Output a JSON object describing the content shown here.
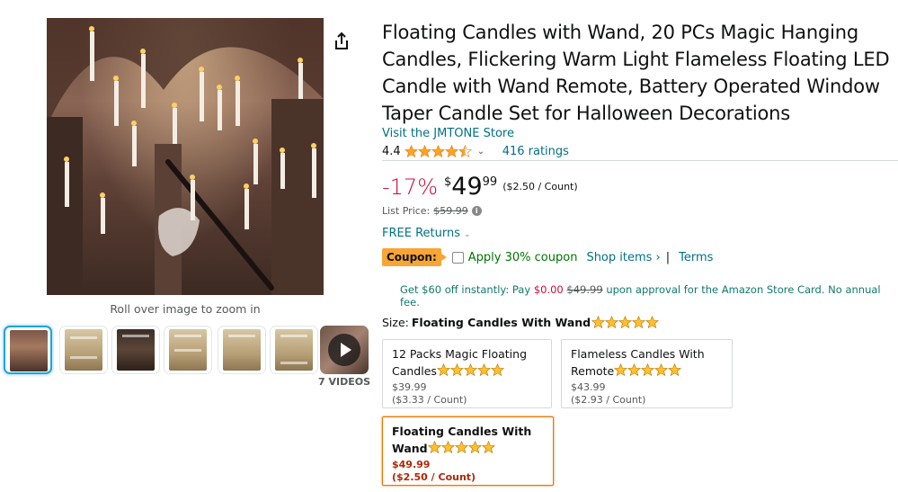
{
  "product": {
    "title": "Floating Candles with Wand, 20 PCs Magic Hanging Candles, Flickering Warm Light Flameless Floating LED Candle with Wand Remote, Battery Operated Window Taper Candle Set for Halloween Decorations",
    "store_link": "Visit the JMTONE Store",
    "rating": "4.4",
    "stars_icon": "star-rating-4.5-icon",
    "ratings_count": "416 ratings"
  },
  "price": {
    "discount": "-17%",
    "currency": "$",
    "whole": "49",
    "fraction": "99",
    "per_unit": "($2.50 / Count)",
    "list_price_label": "List Price:",
    "list_price": "$59.99"
  },
  "returns": {
    "label": "FREE Returns"
  },
  "coupon": {
    "badge": "Coupon:",
    "text": "Apply 30% coupon",
    "shop_items": "Shop items ›",
    "separator": "|",
    "terms": "Terms"
  },
  "card_offer": {
    "prefix": "Get $60 off instantly: Pay",
    "pay_price": "$0.00",
    "old_price": "$49.99",
    "suffix": "upon approval for the Amazon Store Card. No annual fee."
  },
  "gallery": {
    "zoom_hint": "Roll over image to zoom in",
    "video_count": "7 VIDEOS"
  },
  "size": {
    "label": "Size:",
    "selected": "Floating Candles With Wand",
    "options": [
      {
        "name": "12 Packs Magic Floating Candles",
        "price": "$39.99",
        "unit": "($3.33 / Count)"
      },
      {
        "name": "Flameless Candles With Remote",
        "price": "$43.99",
        "unit": "($2.93 / Count)"
      },
      {
        "name": "Floating Candles With Wand",
        "price": "$49.99",
        "unit": "($2.50 / Count)"
      }
    ]
  },
  "colors": {
    "link": "#007185",
    "discount_red": "#cc0c39",
    "coupon_orange": "#f7a535",
    "star_gold": "#ffa41c",
    "coupon_green": "#007600",
    "selected_border": "#e77600"
  }
}
